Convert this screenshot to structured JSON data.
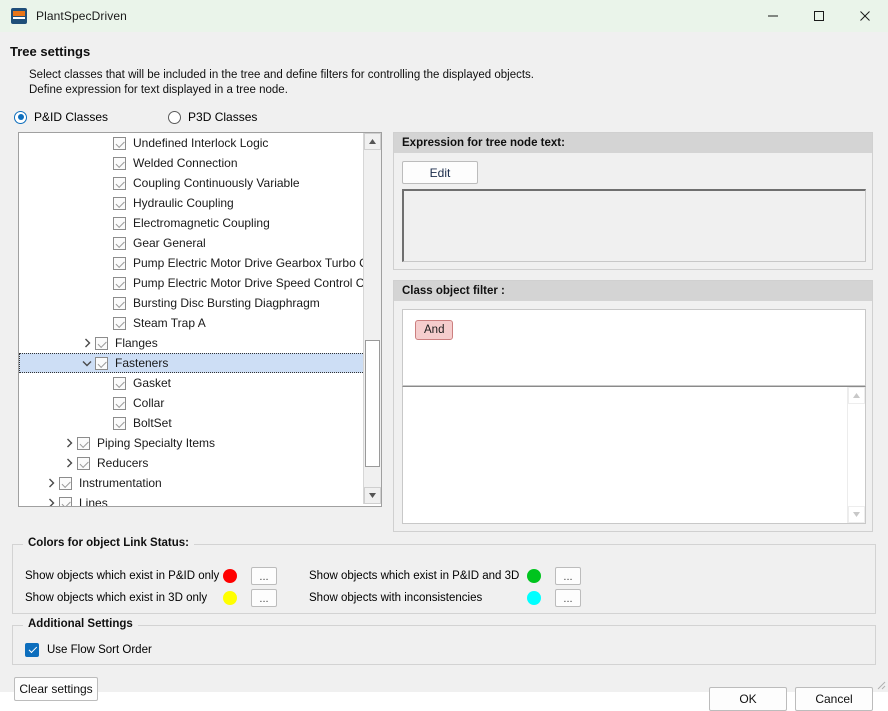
{
  "window": {
    "title": "PlantSpecDriven",
    "icon": "app-icon",
    "controls": {
      "minimize": "minimize-icon",
      "maximize": "maximize-icon",
      "close": "close-icon"
    }
  },
  "header": {
    "title": "Tree settings",
    "description_line1": "Select classes that will be included in the tree and define filters for controlling the displayed objects.",
    "description_line2": "Define expression for text displayed in a tree node."
  },
  "class_mode": {
    "options": [
      {
        "label": "P&ID Classes",
        "selected": true
      },
      {
        "label": "P3D Classes",
        "selected": false
      }
    ]
  },
  "tree": {
    "rows": [
      {
        "label": "Undefined Interlock Logic",
        "indent": 4,
        "twisty": "none",
        "checked": true,
        "selected": false
      },
      {
        "label": "Welded Connection",
        "indent": 4,
        "twisty": "none",
        "checked": true,
        "selected": false
      },
      {
        "label": "Coupling Continuously Variable",
        "indent": 4,
        "twisty": "none",
        "checked": true,
        "selected": false
      },
      {
        "label": "Hydraulic Coupling",
        "indent": 4,
        "twisty": "none",
        "checked": true,
        "selected": false
      },
      {
        "label": "Electromagnetic Coupling",
        "indent": 4,
        "twisty": "none",
        "checked": true,
        "selected": false
      },
      {
        "label": "Gear General",
        "indent": 4,
        "twisty": "none",
        "checked": true,
        "selected": false
      },
      {
        "label": "Pump Electric Motor Drive Gearbox Turbo Coupling",
        "indent": 4,
        "twisty": "none",
        "checked": true,
        "selected": false
      },
      {
        "label": "Pump Electric Motor Drive Speed Control Coupling ...",
        "indent": 4,
        "twisty": "none",
        "checked": true,
        "selected": false
      },
      {
        "label": "Bursting Disc Bursting Diagphragm",
        "indent": 4,
        "twisty": "none",
        "checked": true,
        "selected": false
      },
      {
        "label": "Steam Trap A",
        "indent": 4,
        "twisty": "none",
        "checked": true,
        "selected": false
      },
      {
        "label": "Flanges",
        "indent": 3,
        "twisty": "collapsed",
        "checked": true,
        "selected": false
      },
      {
        "label": "Fasteners",
        "indent": 3,
        "twisty": "expanded",
        "checked": true,
        "selected": true
      },
      {
        "label": "Gasket",
        "indent": 4,
        "twisty": "none",
        "checked": true,
        "selected": false
      },
      {
        "label": "Collar",
        "indent": 4,
        "twisty": "none",
        "checked": true,
        "selected": false
      },
      {
        "label": "BoltSet",
        "indent": 4,
        "twisty": "none",
        "checked": true,
        "selected": false
      },
      {
        "label": "Piping Specialty Items",
        "indent": 2,
        "twisty": "collapsed",
        "checked": true,
        "selected": false
      },
      {
        "label": "Reducers",
        "indent": 2,
        "twisty": "collapsed",
        "checked": true,
        "selected": false
      },
      {
        "label": "Instrumentation",
        "indent": 1,
        "twisty": "collapsed",
        "checked": true,
        "selected": false
      },
      {
        "label": "Lines",
        "indent": 1,
        "twisty": "collapsed",
        "checked": true,
        "selected": false
      }
    ],
    "scrollbar": {
      "up_arrow": "scroll-up-icon",
      "down_arrow": "scroll-down-icon"
    }
  },
  "expression_panel": {
    "header": "Expression for tree node text:",
    "edit_label": "Edit",
    "text_value": ""
  },
  "filter_panel": {
    "header": "Class object filter :",
    "chip_label": "And",
    "chip_bg": "#f5cdcd",
    "chip_border": "#cc7f7f",
    "list_value": ""
  },
  "colors": {
    "legend": "Colors for object Link Status:",
    "items": [
      {
        "label": "Show objects which exist in P&ID only",
        "color": "#ff0000",
        "button": "..."
      },
      {
        "label": "Show objects which exist in P&ID and 3D",
        "color": "#00c41e",
        "button": "..."
      },
      {
        "label": "Show objects which exist in 3D only",
        "color": "#ffff00",
        "button": "..."
      },
      {
        "label": "Show objects with inconsistencies",
        "color": "#00ffff",
        "button": "..."
      }
    ]
  },
  "additional": {
    "legend": "Additional Settings",
    "flow_sort_label": "Use Flow Sort Order",
    "flow_sort_checked": true,
    "accent": "#0d6ebd"
  },
  "footer": {
    "clear_label": "Clear settings",
    "ok_label": "OK",
    "cancel_label": "Cancel"
  }
}
